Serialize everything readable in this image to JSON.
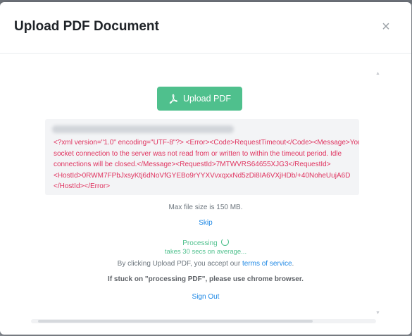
{
  "modal": {
    "title": "Upload PDF Document",
    "close_glyph": "×"
  },
  "upload_button": {
    "label": "Upload PDF",
    "icon": "pdf-icon",
    "color": "#4fc08d"
  },
  "error_box": {
    "text": "<?xml version=\"1.0\" encoding=\"UTF-8\"?> <Error><Code>RequestTimeout</Code><Message>Your\nsocket connection to the server was not read from or written to within the timeout period. Idle\nconnections will be closed.</Message><RequestId>7MTWVRS64655XJG3</RequestId>\n<HostId>0RWM7FPbJxsyKtj6dNoVfGYEBo9rYYXVvxqxxNd5zDi8IA6VXjHDb/+40NoheUujA6D\n</HostId></Error>"
  },
  "info": {
    "max_size": "Max file size is 150 MB.",
    "skip": "Skip",
    "processing": "Processing",
    "avg_time": "takes 30 secs on average...",
    "consent_prefix": "By clicking Upload PDF, you accept our ",
    "terms_link": "terms of service",
    "consent_suffix": ".",
    "stuck": "If stuck on \"processing PDF\", please use chrome browser.",
    "sign_out": "Sign Out"
  },
  "colors": {
    "accent_green": "#4fc08d",
    "link_blue": "#1e88e5",
    "error_red": "#e0335f"
  }
}
